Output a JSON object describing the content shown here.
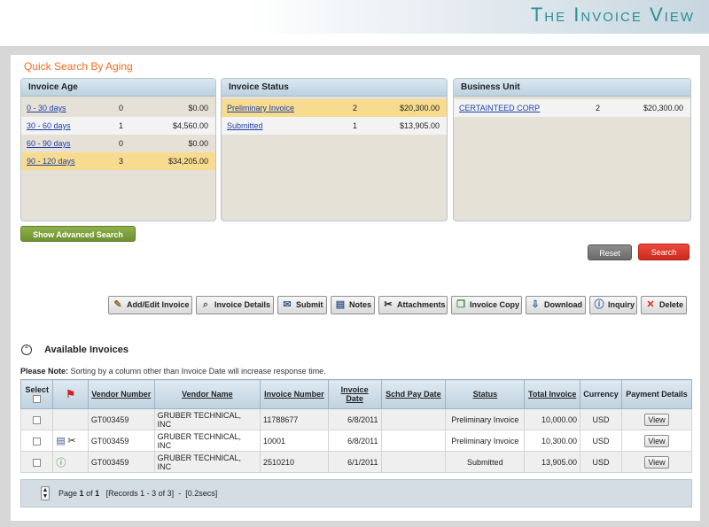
{
  "banner": {
    "title": "The Invoice View"
  },
  "quick_search": {
    "title": "Quick Search By Aging",
    "invoice_age": {
      "header": "Invoice Age",
      "rows": [
        {
          "label": "0 - 30 days",
          "count": "0",
          "amount": "$0.00"
        },
        {
          "label": "30 - 60 days",
          "count": "1",
          "amount": "$4,560.00"
        },
        {
          "label": "60 - 90 days",
          "count": "0",
          "amount": "$0.00"
        },
        {
          "label": "90 - 120 days",
          "count": "3",
          "amount": "$34,205.00"
        }
      ]
    },
    "invoice_status": {
      "header": "Invoice Status",
      "rows": [
        {
          "label": "Preliminary Invoice",
          "count": "2",
          "amount": "$20,300.00"
        },
        {
          "label": "Submitted",
          "count": "1",
          "amount": "$13,905.00"
        }
      ]
    },
    "business_unit": {
      "header": "Business Unit",
      "rows": [
        {
          "label": "CERTAINTEED CORP",
          "count": "2",
          "amount": "$20,300.00"
        }
      ]
    }
  },
  "buttons": {
    "advanced_search": "Show Advanced Search",
    "reset": "Reset",
    "search": "Search"
  },
  "toolbar": [
    {
      "label": "Add/Edit Invoice",
      "icon": "edit-icon"
    },
    {
      "label": "Invoice Details",
      "icon": "magnifier-icon"
    },
    {
      "label": "Submit",
      "icon": "envelope-icon"
    },
    {
      "label": "Notes",
      "icon": "notes-icon"
    },
    {
      "label": "Attachments",
      "icon": "paperclip-icon"
    },
    {
      "label": "Invoice Copy",
      "icon": "copy-icon"
    },
    {
      "label": "Download",
      "icon": "download-icon"
    },
    {
      "label": "Inquiry",
      "icon": "info-icon"
    },
    {
      "label": "Delete",
      "icon": "delete-icon"
    }
  ],
  "invoices": {
    "title": "Available Invoices",
    "note_label": "Please Note:",
    "note_text": "Sorting by a column other than Invoice Date will increase response time.",
    "columns": [
      "Select",
      "Vendor Number",
      "Vendor Name",
      "Invoice Number",
      "Invoice Date",
      "Schd Pay Date",
      "Status",
      "Total Invoice",
      "Currency",
      "Payment Details"
    ],
    "rows": [
      {
        "vendor_number": "GT003459",
        "vendor_name": "GRUBER TECHNICAL, INC",
        "invoice_number": "11788677",
        "invoice_date": "6/8/2011",
        "schd_pay_date": "",
        "status": "Preliminary Invoice",
        "total": "10,000.00",
        "currency": "USD",
        "action": "View",
        "icons": []
      },
      {
        "vendor_number": "GT003459",
        "vendor_name": "GRUBER TECHNICAL, INC",
        "invoice_number": "10001",
        "invoice_date": "6/8/2011",
        "schd_pay_date": "",
        "status": "Preliminary Invoice",
        "total": "10,300.00",
        "currency": "USD",
        "action": "View",
        "icons": [
          "notes-icon",
          "paperclip-icon"
        ]
      },
      {
        "vendor_number": "GT003459",
        "vendor_name": "GRUBER TECHNICAL, INC",
        "invoice_number": "2510210",
        "invoice_date": "6/1/2011",
        "schd_pay_date": "",
        "status": "Submitted",
        "total": "13,905.00",
        "currency": "USD",
        "action": "View",
        "icons": [
          "info-icon"
        ]
      }
    ]
  },
  "pager": {
    "page_prefix": "Page",
    "page_current": "1",
    "page_of": "of",
    "page_total": "1",
    "records": "[Records 1 - 3 of 3]",
    "sep": "-",
    "timing": "[0.2secs]"
  }
}
